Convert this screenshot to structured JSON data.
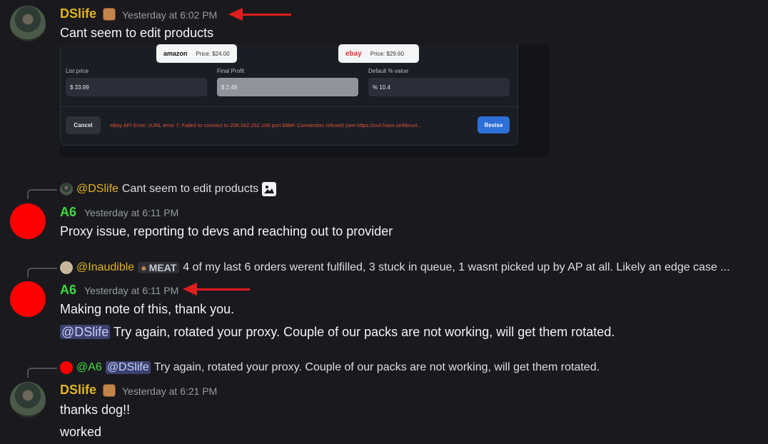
{
  "messages": [
    {
      "username": "DSlife",
      "timestamp": "Yesterday at 6:02 PM",
      "text": "Cant seem to edit products",
      "embed": {
        "amazon_logo": "amazon",
        "amazon_price": "Price: $24.00",
        "ebay_logo": "ebay",
        "ebay_price": "Price: $29.60",
        "list_price_label": "List price",
        "list_price_value": "$ 33.99",
        "final_profit_label": "Final Profit",
        "final_profit_value": "$ 2.49",
        "default_value_label": "Default % value",
        "default_value_value": "% 10.4",
        "cancel_label": "Cancel",
        "error_text": "eBay API Error: cURL error 7: Failed to connect to 206.162.252.108 port 6884: Connection refused (see https://curl.haxx.se/libcurl...",
        "revise_label": "Revise"
      }
    },
    {
      "reply_author": "@DSlife",
      "reply_text": "Cant seem to edit products",
      "username": "A6",
      "timestamp": "Yesterday at 6:11 PM",
      "text": "Proxy issue, reporting to devs and reaching out to provider"
    },
    {
      "reply_author": "@Inaudible",
      "reply_badge": "MEAT",
      "reply_text": "4 of my last 6 orders werent fulfilled, 3 stuck in queue, 1 wasnt picked up by AP at all. Likely an edge case ...",
      "username": "A6",
      "timestamp": "Yesterday at 6:11 PM",
      "text": "Making note of this, thank you.",
      "mention": "@DSlife",
      "text2": "Try again, rotated your proxy. Couple of our packs are not working, will get them rotated."
    },
    {
      "reply_author": "@A6",
      "reply_mention": "@DSlife",
      "reply_text": "Try again, rotated your proxy. Couple of our packs are not working, will get them rotated.",
      "username": "DSlife",
      "timestamp": "Yesterday at 6:21 PM",
      "text": "thanks dog!!",
      "text2": "worked"
    }
  ],
  "colors": {
    "background": "#1a1a1e",
    "dslife_name": "#e2b422",
    "a6_name": "#3ddc3d",
    "annotation_arrow": "#e01e1e",
    "mention_bg": "#3c4270"
  }
}
